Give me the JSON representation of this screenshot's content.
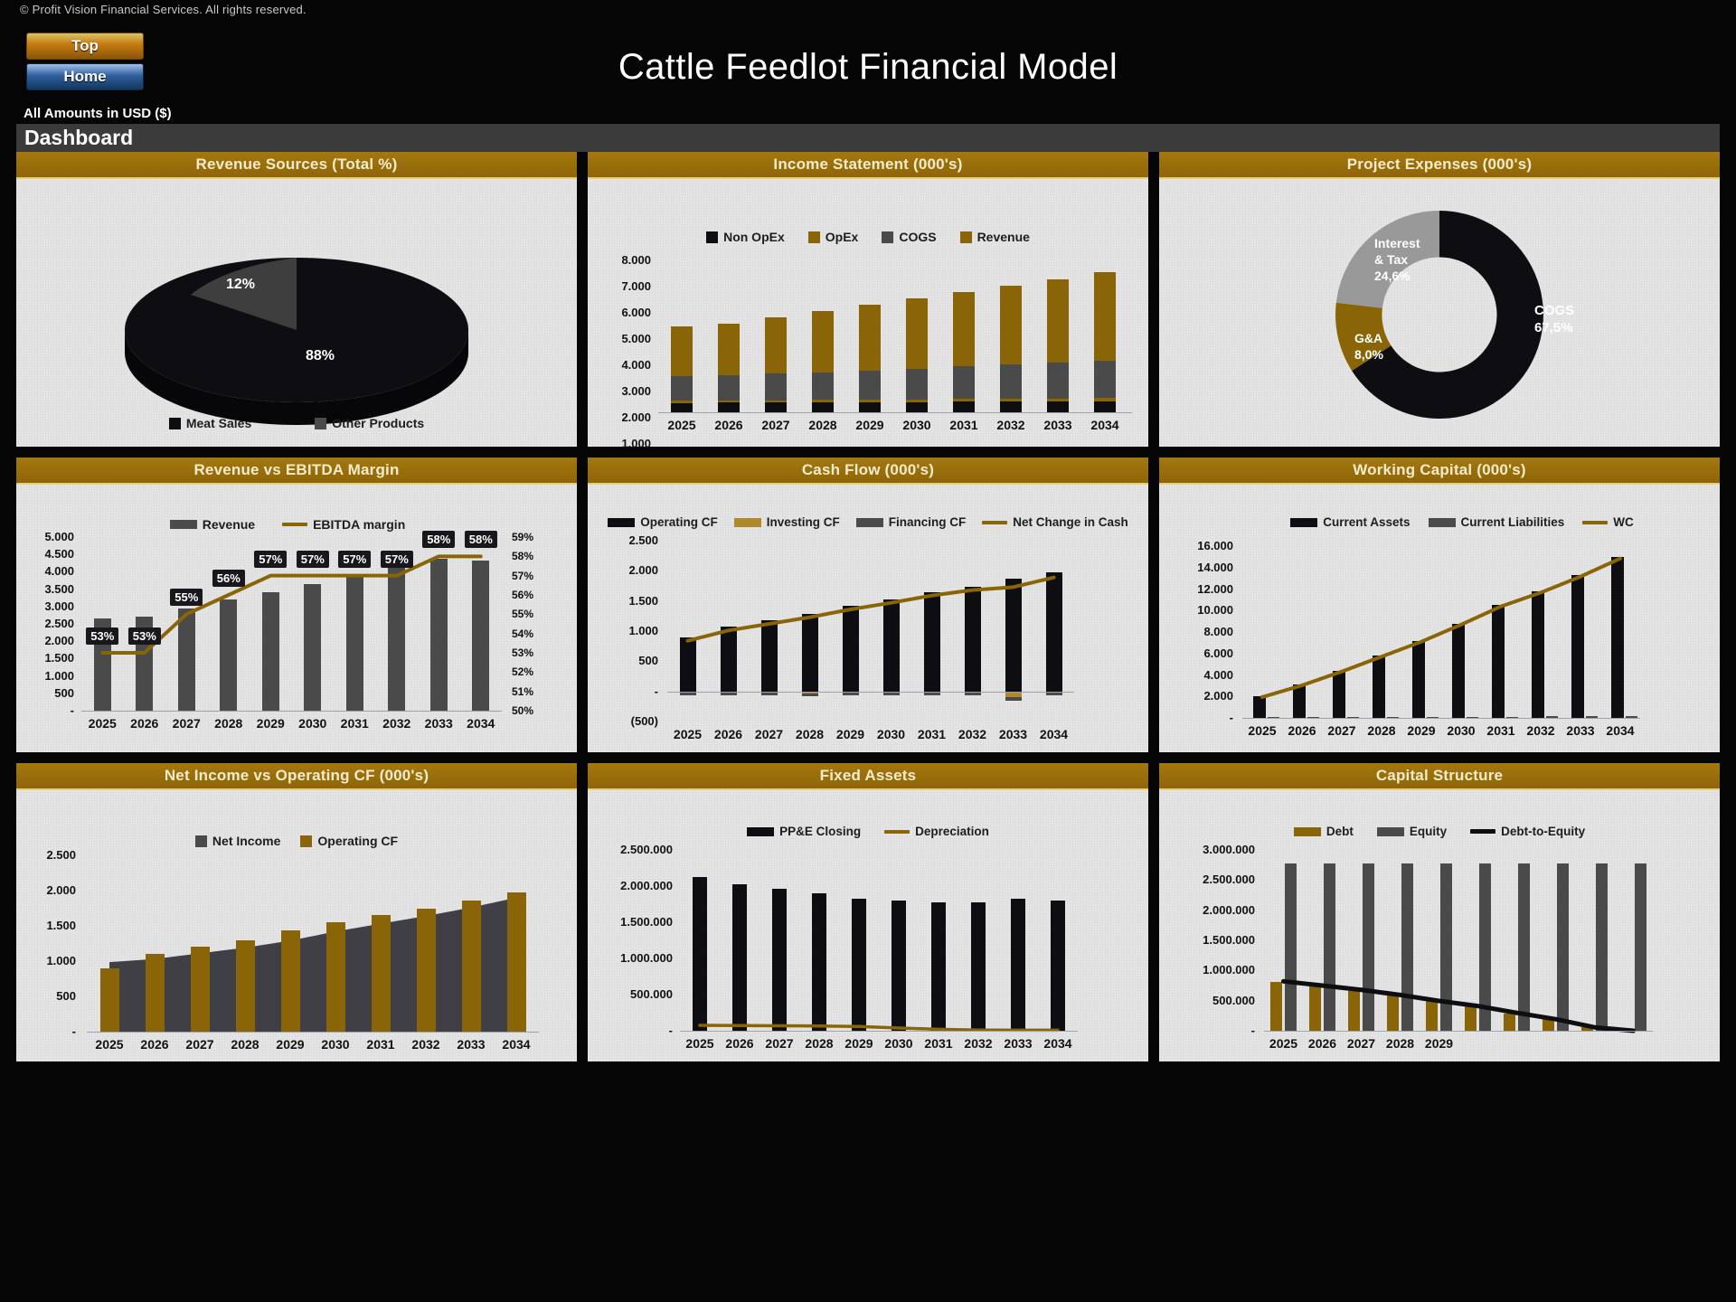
{
  "header": {
    "copyright": "© Profit Vision Financial Services. All rights reserved.",
    "btn_top": "Top",
    "btn_home": "Home",
    "title": "Cattle Feedlot Financial Model",
    "amounts": "All Amounts in  USD ($)",
    "dashboard": "Dashboard"
  },
  "colors": {
    "gold": "#8a6508",
    "gold_light": "#a4780f",
    "black": "#0d0d12",
    "gray": "#4a4a4a",
    "gray_light": "#999999",
    "panel_bg": "#dedede",
    "title_text": "#f6eccd"
  },
  "panels": {
    "revenue_sources": "Revenue Sources (Total %)",
    "income_statement": "Income Statement (000's)",
    "project_expenses": "Project Expenses (000's)",
    "revenue_ebitda": "Revenue vs EBITDA Margin",
    "cash_flow": "Cash Flow (000's)",
    "working_capital": "Working Capital (000's)",
    "net_income_opcf": "Net Income vs Operating CF (000's)",
    "fixed_assets": "Fixed Assets",
    "capital_structure": "Capital Structure"
  },
  "chart_data": [
    {
      "id": "revenue_sources",
      "type": "pie",
      "title": "Revenue Sources (Total %)",
      "labels": [
        "Meat Sales",
        "Other Products"
      ],
      "values": [
        88,
        12
      ],
      "value_labels": [
        "88%",
        "12%"
      ],
      "colors": [
        "#0d0d12",
        "#4a4a4a"
      ],
      "legend": [
        "Meat Sales",
        "Other Products"
      ],
      "legend_position": "bottom",
      "three_d": true
    },
    {
      "id": "income_statement",
      "type": "bar",
      "title": "Income Statement (000's)",
      "stacked": true,
      "categories": [
        "2025",
        "2026",
        "2027",
        "2028",
        "2029",
        "2030",
        "2031",
        "2032",
        "2033",
        "2034"
      ],
      "series": [
        {
          "name": "Non OpEx",
          "color": "#0d0d12",
          "values": [
            480,
            490,
            500,
            510,
            520,
            530,
            540,
            550,
            560,
            570
          ]
        },
        {
          "name": "OpEx",
          "color": "#8a6508",
          "values": [
            110,
            115,
            120,
            125,
            130,
            135,
            140,
            145,
            150,
            155
          ]
        },
        {
          "name": "COGS",
          "color": "#4a4a4a",
          "values": [
            1290,
            1320,
            1360,
            1420,
            1500,
            1590,
            1680,
            1760,
            1840,
            1930
          ]
        },
        {
          "name": "Revenue",
          "color": "#8a6508",
          "values": [
            2520,
            2655,
            2890,
            3165,
            3390,
            3615,
            3830,
            4035,
            4280,
            4555
          ]
        }
      ],
      "ytick_labels": [
        "8.000",
        "7.000",
        "6.000",
        "5.000",
        "4.000",
        "3.000",
        "2.000",
        "1.000",
        "-"
      ],
      "ylim": [
        0,
        8000
      ],
      "totals": [
        4400,
        4580,
        4870,
        5220,
        5540,
        5870,
        6190,
        6490,
        6830,
        7210
      ],
      "legend": [
        "Non OpEx",
        "OpEx",
        "COGS",
        "Revenue"
      ],
      "legend_position": "top"
    },
    {
      "id": "project_expenses",
      "type": "pie",
      "title": "Project Expenses (000's)",
      "donut": true,
      "labels": [
        "COGS",
        "Interest & Tax",
        "G&A"
      ],
      "values": [
        67.5,
        24.6,
        8.0
      ],
      "value_labels": [
        "67,5%",
        "24,6%",
        "8,0%"
      ],
      "annotations": [
        "COGS\n67,5%",
        "Interest\n& Tax\n24,6%",
        "G&A\n8,0%"
      ],
      "colors": [
        "#0d0d12",
        "#999999",
        "#8a6508"
      ]
    },
    {
      "id": "revenue_ebitda",
      "type": "bar",
      "title": "Revenue vs EBITDA Margin",
      "categories": [
        "2025",
        "2026",
        "2027",
        "2028",
        "2029",
        "2030",
        "2031",
        "2032",
        "2033",
        "2034"
      ],
      "series": [
        {
          "name": "Revenue",
          "color": "#4a4a4a",
          "type": "bar",
          "values": [
            2650,
            2700,
            2950,
            3200,
            3420,
            3640,
            3880,
            4120,
            4380,
            4320
          ]
        },
        {
          "name": "EBITDA margin",
          "color": "#8a6508",
          "type": "line",
          "values": [
            53,
            53,
            55,
            56,
            57,
            57,
            57,
            57,
            58,
            58
          ],
          "data_labels": [
            "53%",
            "53%",
            "55%",
            "56%",
            "57%",
            "57%",
            "57%",
            "57%",
            "58%",
            "58%"
          ]
        }
      ],
      "ytick_labels": [
        "5.000",
        "4.500",
        "4.000",
        "3.500",
        "3.000",
        "2.500",
        "2.000",
        "1.500",
        "1.000",
        "500",
        "-"
      ],
      "ylim": [
        0,
        5000
      ],
      "y2tick_labels": [
        "59%",
        "58%",
        "57%",
        "56%",
        "55%",
        "54%",
        "53%",
        "52%",
        "51%",
        "50%"
      ],
      "y2lim": [
        50,
        59
      ],
      "legend": [
        "Revenue",
        "EBITDA margin"
      ],
      "legend_position": "top"
    },
    {
      "id": "cash_flow",
      "type": "bar",
      "title": "Cash Flow (000's)",
      "categories": [
        "2025",
        "2026",
        "2027",
        "2028",
        "2029",
        "2030",
        "2031",
        "2032",
        "2033",
        "2034"
      ],
      "series": [
        {
          "name": "Operating CF",
          "color": "#0d0d12",
          "type": "bar",
          "values": [
            900,
            1070,
            1180,
            1290,
            1420,
            1530,
            1650,
            1740,
            1870,
            1980
          ]
        },
        {
          "name": "Investing CF",
          "color": "#8a6508",
          "type": "bar",
          "values": [
            -10,
            -10,
            -10,
            -30,
            -12,
            -12,
            -12,
            -12,
            -90,
            -12
          ]
        },
        {
          "name": "Financing CF",
          "color": "#4a4a4a",
          "type": "bar",
          "values": [
            -55,
            -55,
            -55,
            -55,
            -55,
            -55,
            -55,
            -55,
            -60,
            -55
          ]
        },
        {
          "name": "Net Change in Cash",
          "color": "#8a6508",
          "type": "line",
          "values": [
            840,
            1010,
            1120,
            1230,
            1360,
            1470,
            1590,
            1680,
            1730,
            1890
          ]
        }
      ],
      "ytick_labels": [
        "2.500",
        "2.000",
        "1.500",
        "1.000",
        "500",
        "-",
        "(500)"
      ],
      "ylim": [
        -500,
        2500
      ],
      "legend": [
        "Operating CF",
        "Investing CF",
        "Financing CF",
        "Net Change in Cash"
      ],
      "legend_position": "top"
    },
    {
      "id": "working_capital",
      "type": "bar",
      "title": "Working Capital (000's)",
      "categories": [
        "2025",
        "2026",
        "2027",
        "2028",
        "2029",
        "2030",
        "2031",
        "2032",
        "2033",
        "2034"
      ],
      "series": [
        {
          "name": "Current Assets",
          "color": "#0d0d12",
          "type": "bar",
          "values": [
            2000,
            3100,
            4400,
            5800,
            7200,
            8800,
            10500,
            11800,
            13300,
            15000
          ]
        },
        {
          "name": "Current Liabilities",
          "color": "#4a4a4a",
          "type": "bar",
          "values": [
            60,
            70,
            80,
            90,
            100,
            110,
            120,
            130,
            140,
            150
          ]
        },
        {
          "name": "WC",
          "color": "#8a6508",
          "type": "line",
          "values": [
            1940,
            3030,
            4320,
            5710,
            7100,
            8690,
            10380,
            11670,
            13160,
            14850
          ]
        }
      ],
      "ytick_labels": [
        "16.000",
        "14.000",
        "12.000",
        "10.000",
        "8.000",
        "6.000",
        "4.000",
        "2.000",
        "-"
      ],
      "ylim": [
        0,
        16000
      ],
      "legend": [
        "Current Assets",
        "Current Liabilities",
        "WC"
      ],
      "legend_position": "top"
    },
    {
      "id": "net_income_opcf",
      "type": "area",
      "title": "Net Income vs Operating CF (000's)",
      "categories": [
        "2025",
        "2026",
        "2027",
        "2028",
        "2029",
        "2030",
        "2031",
        "2032",
        "2033",
        "2034"
      ],
      "series": [
        {
          "name": "Net Income",
          "color": "#4a4a4a",
          "type": "area",
          "values": [
            985,
            1030,
            1110,
            1190,
            1290,
            1420,
            1530,
            1640,
            1760,
            1900
          ]
        },
        {
          "name": "Operating CF",
          "color": "#8a6508",
          "type": "bar",
          "values": [
            900,
            1100,
            1200,
            1300,
            1440,
            1550,
            1660,
            1750,
            1860,
            1970
          ]
        }
      ],
      "ytick_labels": [
        "2.500",
        "2.000",
        "1.500",
        "1.000",
        "500",
        "-"
      ],
      "ylim": [
        0,
        2500
      ],
      "legend": [
        "Net Income",
        "Operating CF"
      ],
      "legend_position": "top"
    },
    {
      "id": "fixed_assets",
      "type": "bar",
      "title": "Fixed Assets",
      "categories": [
        "2025",
        "2026",
        "2027",
        "2028",
        "2029",
        "2030",
        "2031",
        "2032",
        "2033",
        "2034"
      ],
      "series": [
        {
          "name": "PP&E Closing",
          "color": "#0d0d12",
          "type": "bar",
          "values": [
            2130000,
            2030000,
            1960000,
            1900000,
            1820000,
            1800000,
            1770000,
            1780000,
            1820000,
            1800000
          ]
        },
        {
          "name": "Depreciation",
          "color": "#8a6508",
          "type": "line",
          "values": [
            75000,
            72000,
            68000,
            66000,
            60000,
            38000,
            20000,
            10000,
            8000,
            8000
          ]
        }
      ],
      "ytick_labels": [
        "2.500.000",
        "2.000.000",
        "1.500.000",
        "1.000.000",
        "500.000",
        "-"
      ],
      "ylim": [
        0,
        2500000
      ],
      "legend": [
        "PP&E Closing",
        "Depreciation"
      ],
      "legend_position": "top"
    },
    {
      "id": "capital_structure",
      "type": "bar",
      "title": "Capital Structure",
      "categories": [
        "2025",
        "2026",
        "2027",
        "2028",
        "2029",
        "",
        "",
        "",
        "",
        ""
      ],
      "visible_xlabels": [
        "2025",
        "2026",
        "2027",
        "2028",
        "2029"
      ],
      "series": [
        {
          "name": "Debt",
          "color": "#8a6508",
          "type": "bar",
          "values": [
            810000,
            745000,
            665000,
            580000,
            490000,
            400000,
            290000,
            190000,
            55000,
            0
          ]
        },
        {
          "name": "Equity",
          "color": "#4a4a4a",
          "type": "bar",
          "values": [
            2780000,
            2780000,
            2780000,
            2780000,
            2780000,
            2780000,
            2780000,
            2780000,
            2780000,
            2780000
          ]
        },
        {
          "name": "Debt-to-Equity",
          "color": "#0d0d12",
          "type": "line",
          "values": [
            0.29,
            0.265,
            0.24,
            0.21,
            0.175,
            0.145,
            0.105,
            0.068,
            0.02,
            0.0
          ]
        }
      ],
      "ytick_labels": [
        "3.000.000",
        "2.500.000",
        "2.000.000",
        "1.500.000",
        "1.000.000",
        "500.000",
        "-"
      ],
      "ylim": [
        0,
        3000000
      ],
      "legend": [
        "Debt",
        "Equity",
        "Debt-to-Equity"
      ],
      "legend_position": "top"
    }
  ]
}
